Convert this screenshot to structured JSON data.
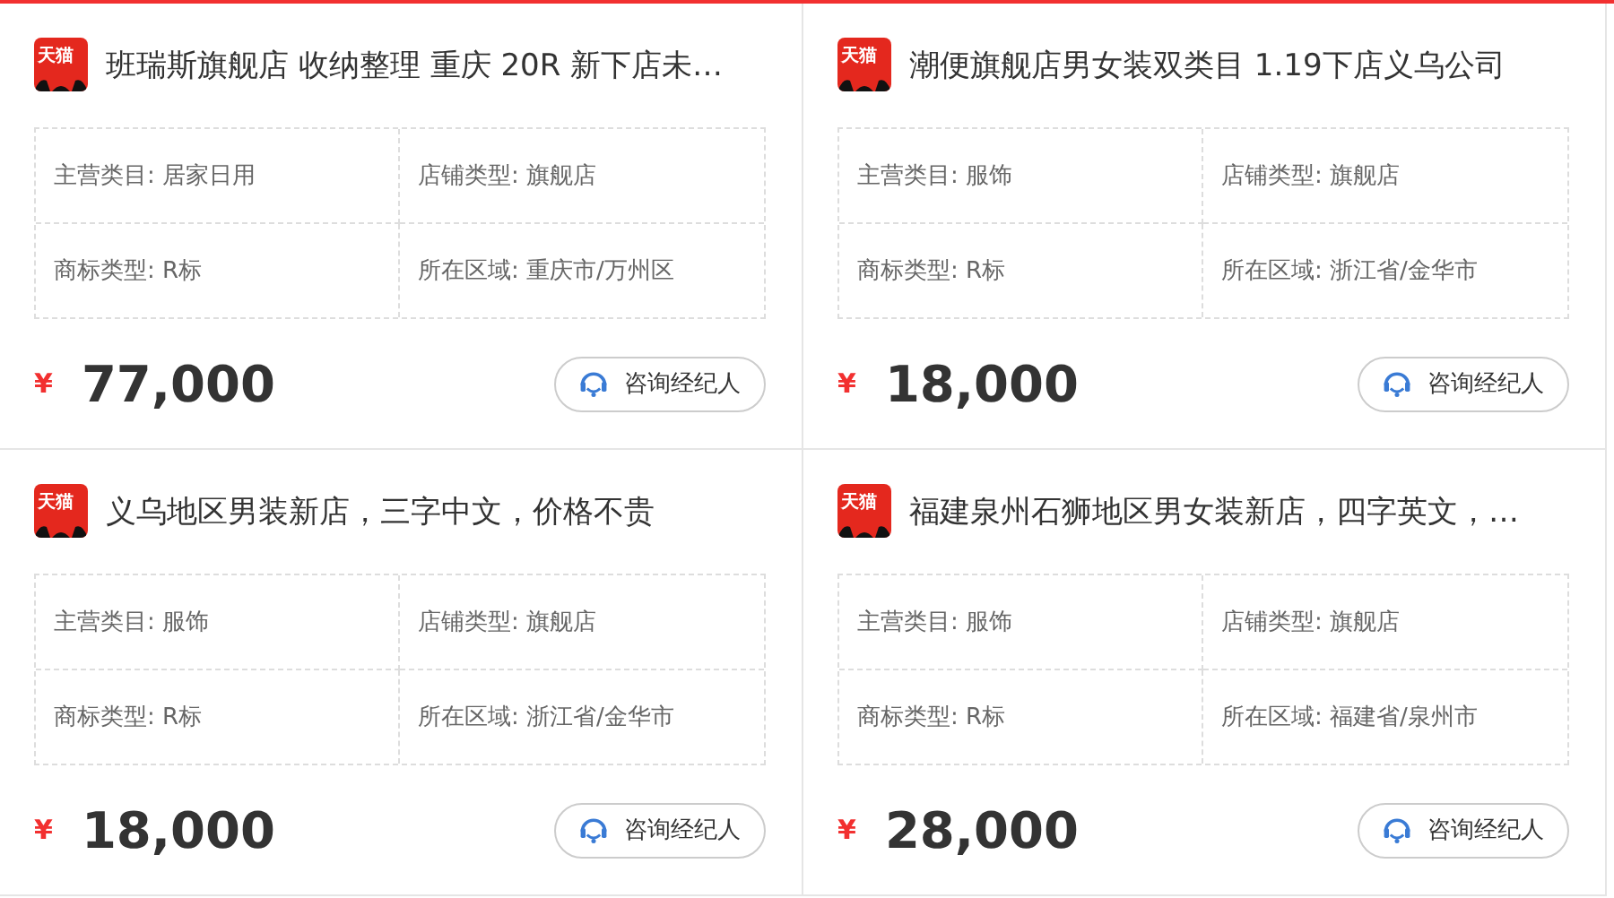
{
  "listings": [
    {
      "badge": "天猫",
      "title": "班瑞斯旗舰店 收纳整理 重庆 20R 新下店未…",
      "fields": [
        {
          "label": "主营类目:",
          "value": "居家日用"
        },
        {
          "label": "店铺类型:",
          "value": "旗舰店"
        },
        {
          "label": "商标类型:",
          "value": "R标"
        },
        {
          "label": "所在区域:",
          "value": "重庆市/万州区"
        }
      ],
      "currency": "¥",
      "price": "77,000",
      "button": "咨询经纪人"
    },
    {
      "badge": "天猫",
      "title": "潮便旗舰店男女装双类目 1.19下店义乌公司",
      "fields": [
        {
          "label": "主营类目:",
          "value": "服饰"
        },
        {
          "label": "店铺类型:",
          "value": "旗舰店"
        },
        {
          "label": "商标类型:",
          "value": "R标"
        },
        {
          "label": "所在区域:",
          "value": "浙江省/金华市"
        }
      ],
      "currency": "¥",
      "price": "18,000",
      "button": "咨询经纪人"
    },
    {
      "badge": "天猫",
      "title": "义乌地区男装新店，三字中文，价格不贵",
      "fields": [
        {
          "label": "主营类目:",
          "value": "服饰"
        },
        {
          "label": "店铺类型:",
          "value": "旗舰店"
        },
        {
          "label": "商标类型:",
          "value": "R标"
        },
        {
          "label": "所在区域:",
          "value": "浙江省/金华市"
        }
      ],
      "currency": "¥",
      "price": "18,000",
      "button": "咨询经纪人"
    },
    {
      "badge": "天猫",
      "title": "福建泉州石狮地区男女装新店，四字英文，…",
      "fields": [
        {
          "label": "主营类目:",
          "value": "服饰"
        },
        {
          "label": "店铺类型:",
          "value": "旗舰店"
        },
        {
          "label": "商标类型:",
          "value": "R标"
        },
        {
          "label": "所在区域:",
          "value": "福建省/泉州市"
        }
      ],
      "currency": "¥",
      "price": "28,000",
      "button": "咨询经纪人"
    }
  ]
}
